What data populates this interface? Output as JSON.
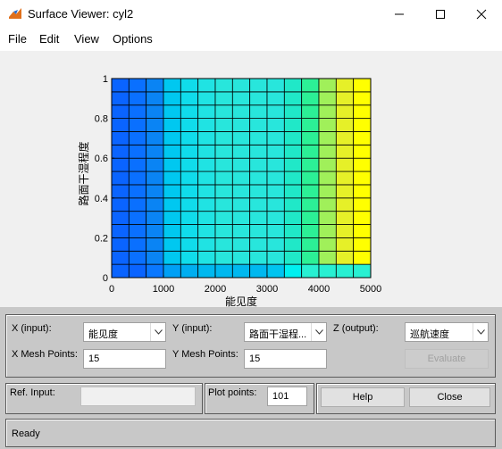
{
  "window": {
    "title": "Surface Viewer: cyl2"
  },
  "menu": [
    "File",
    "Edit",
    "View",
    "Options"
  ],
  "chart_data": {
    "type": "heatmap",
    "xlabel": "能见度",
    "ylabel": "路面干湿程度",
    "xlim": [
      0,
      5000
    ],
    "ylim": [
      0,
      1
    ],
    "x_ticks": [
      "0",
      "1000",
      "2000",
      "3000",
      "4000",
      "5000"
    ],
    "y_ticks": [
      "0",
      "0.2",
      "0.4",
      "0.6",
      "0.8",
      "1"
    ],
    "grid": "15x15 mesh",
    "column_colors": [
      "#0a64ff",
      "#0a70ff",
      "#0a84f4",
      "#00c8f0",
      "#10dceb",
      "#20e3e3",
      "#28e6dc",
      "#28e6dc",
      "#28e6dc",
      "#28e6dc",
      "#20e8c8",
      "#2cf096",
      "#a0f05a",
      "#e6f028",
      "#ffff00"
    ],
    "row_overrides": [
      {
        "row_from_bottom": 0,
        "colors": [
          "#0a64ff",
          "#0a64ff",
          "#0a78ff",
          "#00a0f5",
          "#00aef0",
          "#00b8ef",
          "#00b8ef",
          "#00b8ef",
          "#00b8ef",
          "#00c4f0",
          "#00f0f0",
          "#28f0d2",
          "#28f0d2",
          "#28f0d2",
          "#28f0d2"
        ]
      }
    ]
  },
  "controls": {
    "x_input_label": "X (input):",
    "x_input_value": "能见度",
    "y_input_label": "Y (input):",
    "y_input_value": "路面干湿程...",
    "z_output_label": "Z (output):",
    "z_output_value": "巡航速度",
    "x_mesh_label": "X Mesh Points:",
    "x_mesh_value": "15",
    "y_mesh_label": "Y Mesh Points:",
    "y_mesh_value": "15",
    "evaluate_label": "Evaluate",
    "ref_input_label": "Ref. Input:",
    "ref_input_value": "",
    "plot_points_label": "Plot points:",
    "plot_points_value": "101",
    "help_label": "Help",
    "close_label": "Close",
    "status": "Ready"
  }
}
